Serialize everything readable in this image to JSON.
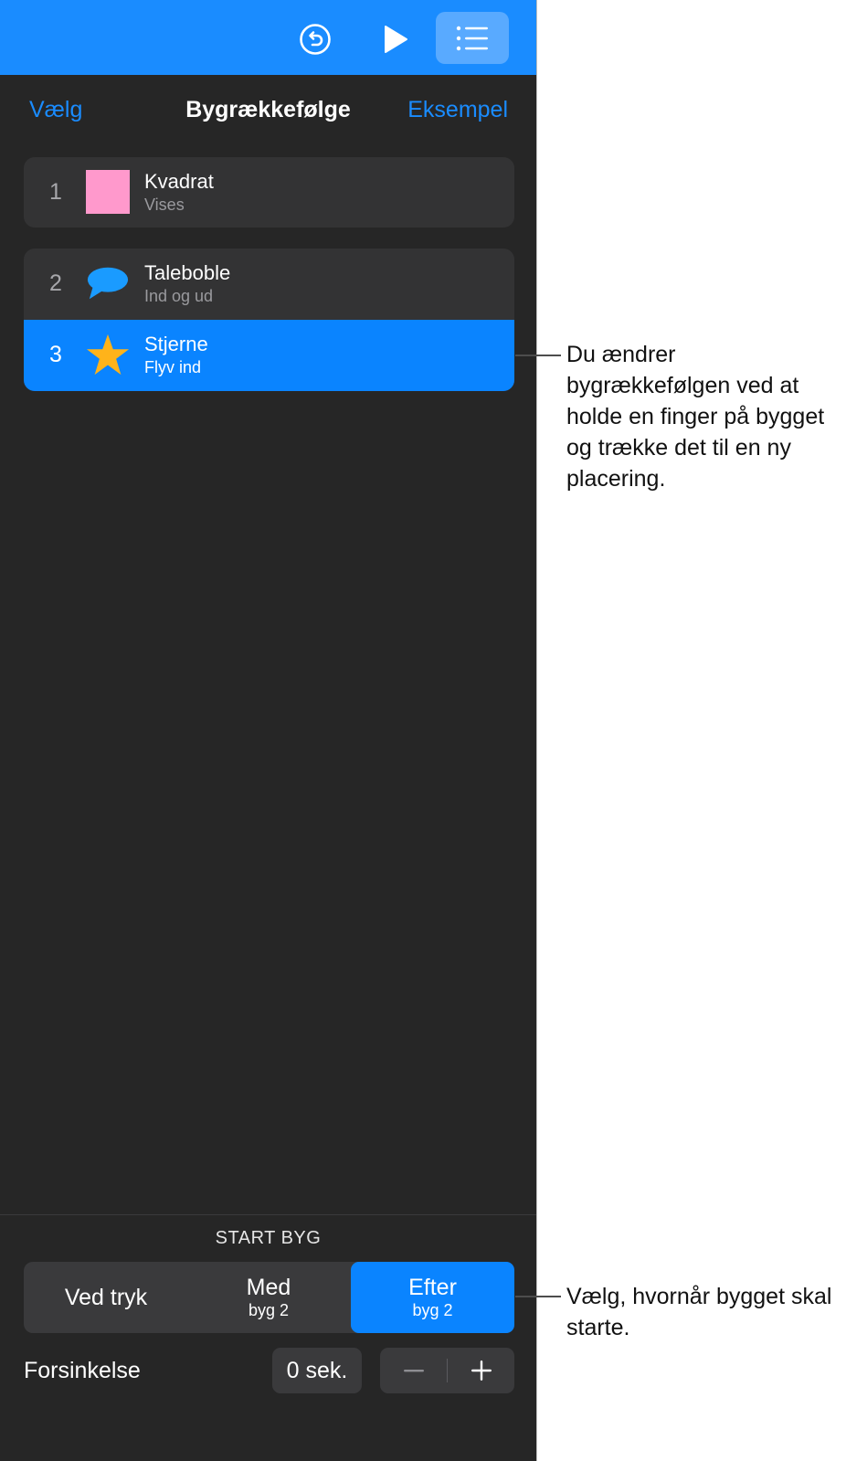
{
  "toolbar": {
    "undo_icon": "undo-icon",
    "play_icon": "play-icon",
    "list_icon": "list-icon",
    "color": "#1a8cff"
  },
  "nav": {
    "left": "Vælg",
    "title": "Bygrækkefølge",
    "right": "Eksempel"
  },
  "builds": [
    {
      "number": "1",
      "title": "Kvadrat",
      "subtitle": "Vises",
      "icon": "pink-square",
      "color": "#ff99cc"
    },
    {
      "number": "2",
      "title": "Taleboble",
      "subtitle": "Ind og ud",
      "icon": "speech-bubble",
      "color": "#1a9bff"
    },
    {
      "number": "3",
      "title": "Stjerne",
      "subtitle": "Flyv ind",
      "icon": "star",
      "color": "#ffb31a",
      "selected": true
    }
  ],
  "start": {
    "label": "START BYG",
    "options": [
      {
        "main": "Ved tryk",
        "sub": ""
      },
      {
        "main": "Med",
        "sub": "byg 2"
      },
      {
        "main": "Efter",
        "sub": "byg 2",
        "selected": true
      }
    ]
  },
  "delay": {
    "label": "Forsinkelse",
    "value": "0 sek.",
    "minus": "−",
    "plus": "+"
  },
  "callouts": [
    "Du ændrer bygrækkefølgen ved at holde en finger på bygget og trække det til en ny placering.",
    "Vælg, hvornår bygget skal starte."
  ]
}
